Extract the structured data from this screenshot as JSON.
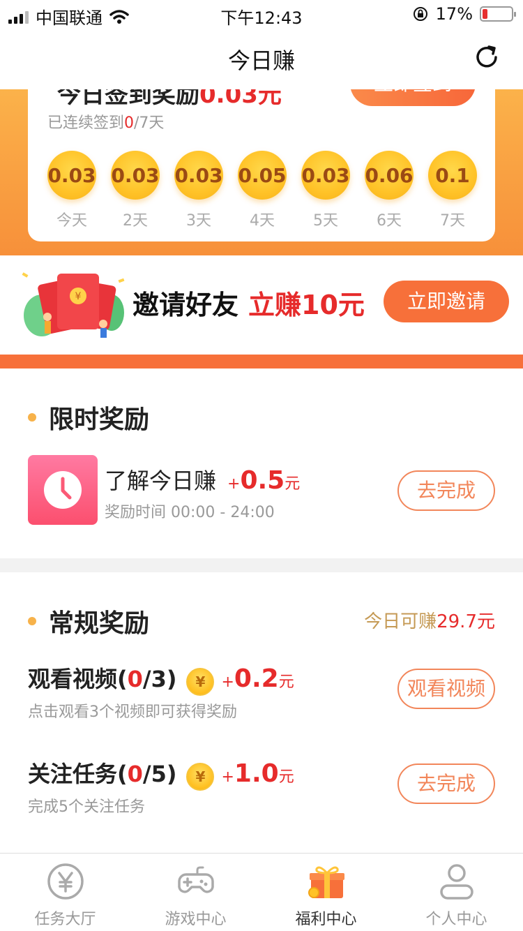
{
  "status_bar": {
    "carrier": "中国联通",
    "time": "下午12:43",
    "battery": "17%",
    "battery_level": 0.17
  },
  "nav": {
    "title": "今日赚"
  },
  "signin": {
    "title_prefix": "今日签到奖励",
    "title_amount": "0.03元",
    "button": "立即签到",
    "streak_prefix": "已连续签到",
    "streak_current": "0",
    "streak_suffix": "/7天",
    "days": [
      {
        "amount": "0.03",
        "label": "今天"
      },
      {
        "amount": "0.03",
        "label": "2天"
      },
      {
        "amount": "0.03",
        "label": "3天"
      },
      {
        "amount": "0.05",
        "label": "4天"
      },
      {
        "amount": "0.03",
        "label": "5天"
      },
      {
        "amount": "0.06",
        "label": "6天"
      },
      {
        "amount": "0.1",
        "label": "7天"
      }
    ]
  },
  "invite": {
    "title": "邀请好友",
    "highlight": "立赚10元",
    "button": "立即邀请",
    "art_symbol": "¥"
  },
  "limited": {
    "title": "限时奖励",
    "task": {
      "name": "了解今日赚",
      "plus": "+",
      "amount": "0.5",
      "unit": "元",
      "sub": "奖励时间 00:00 - 24:00",
      "button": "去完成"
    }
  },
  "regular": {
    "title": "常规奖励",
    "today_prefix": "今日可赚",
    "today_amount": "29.7元",
    "tasks": [
      {
        "name_prefix": "观看视频(",
        "progress": "0",
        "name_suffix": "/3)",
        "plus": "+",
        "amount": "0.2",
        "unit": "元",
        "sub": "点击观看3个视频即可获得奖励",
        "button": "观看视频",
        "coin_symbol": "¥"
      },
      {
        "name_prefix": "关注任务(",
        "progress": "0",
        "name_suffix": "/5)",
        "plus": "+",
        "amount": "1.0",
        "unit": "元",
        "sub": "完成5个关注任务",
        "button": "去完成",
        "coin_symbol": "¥"
      }
    ]
  },
  "tabs": [
    {
      "label": "任务大厅",
      "icon": "yen-circle-icon"
    },
    {
      "label": "游戏中心",
      "icon": "gamepad-icon"
    },
    {
      "label": "福利中心",
      "icon": "gift-icon",
      "active": true
    },
    {
      "label": "个人中心",
      "icon": "user-icon"
    }
  ],
  "colors": {
    "accent": "#f7703a",
    "price_red": "#e62b2b",
    "coin_gold": "#ffc227",
    "band_top": "#fbb24a",
    "band_bottom": "#f7903a"
  }
}
